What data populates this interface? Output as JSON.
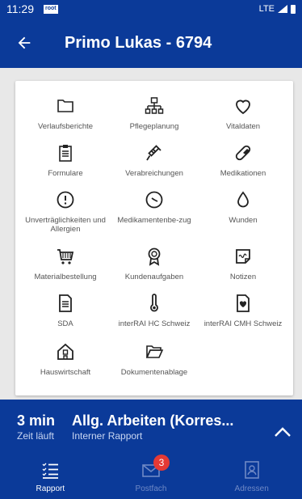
{
  "status": {
    "time": "11:29",
    "root_badge": "root",
    "network": "LTE"
  },
  "header": {
    "title": "Primo Lukas - 6794"
  },
  "menu": [
    {
      "label": "Verlaufsberichte",
      "icon": "folder-icon"
    },
    {
      "label": "Pflegeplanung",
      "icon": "hierarchy-icon"
    },
    {
      "label": "Vitaldaten",
      "icon": "heart-icon"
    },
    {
      "label": "Formulare",
      "icon": "clipboard-icon"
    },
    {
      "label": "Verabreichungen",
      "icon": "syringe-icon"
    },
    {
      "label": "Medikationen",
      "icon": "pill-icon"
    },
    {
      "label": "Unverträglichkeiten und Allergien",
      "icon": "alert-icon"
    },
    {
      "label": "Medikamentenbe-zug",
      "icon": "clock-icon"
    },
    {
      "label": "Wunden",
      "icon": "drop-icon"
    },
    {
      "label": "Materialbestellung",
      "icon": "cart-icon"
    },
    {
      "label": "Kundenaufgaben",
      "icon": "award-icon"
    },
    {
      "label": "Notizen",
      "icon": "note-icon"
    },
    {
      "label": "SDA",
      "icon": "document-icon"
    },
    {
      "label": "interRAI HC Schweiz",
      "icon": "thermometer-icon"
    },
    {
      "label": "interRAI CMH Schweiz",
      "icon": "doc-heart-icon"
    },
    {
      "label": "Hauswirtschaft",
      "icon": "house-icon"
    },
    {
      "label": "Dokumentenablage",
      "icon": "folder-open-icon"
    }
  ],
  "timer": {
    "value": "3 min",
    "label": "Zeit läuft"
  },
  "task": {
    "title": "Allg. Arbeiten (Korres...",
    "subtitle": "Interner Rapport"
  },
  "bottom_nav": [
    {
      "label": "Rapport",
      "icon": "list-icon",
      "active": true
    },
    {
      "label": "Postfach",
      "icon": "mail-icon",
      "badge": "3",
      "active": false
    },
    {
      "label": "Adressen",
      "icon": "contacts-icon",
      "active": false
    }
  ],
  "colors": {
    "primary": "#0b3a99",
    "badge": "#e53935"
  }
}
